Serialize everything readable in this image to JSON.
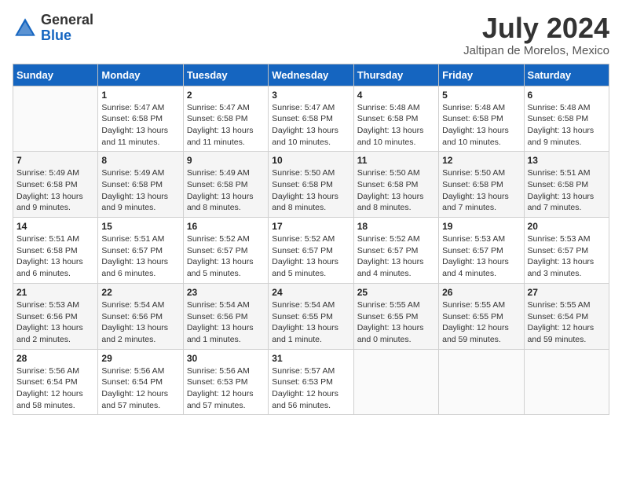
{
  "header": {
    "logo_general": "General",
    "logo_blue": "Blue",
    "month_title": "July 2024",
    "subtitle": "Jaltipan de Morelos, Mexico"
  },
  "columns": [
    "Sunday",
    "Monday",
    "Tuesday",
    "Wednesday",
    "Thursday",
    "Friday",
    "Saturday"
  ],
  "weeks": [
    [
      null,
      {
        "day": "1",
        "sunrise": "5:47 AM",
        "sunset": "6:58 PM",
        "daylight": "13 hours and 11 minutes."
      },
      {
        "day": "2",
        "sunrise": "5:47 AM",
        "sunset": "6:58 PM",
        "daylight": "13 hours and 11 minutes."
      },
      {
        "day": "3",
        "sunrise": "5:47 AM",
        "sunset": "6:58 PM",
        "daylight": "13 hours and 10 minutes."
      },
      {
        "day": "4",
        "sunrise": "5:48 AM",
        "sunset": "6:58 PM",
        "daylight": "13 hours and 10 minutes."
      },
      {
        "day": "5",
        "sunrise": "5:48 AM",
        "sunset": "6:58 PM",
        "daylight": "13 hours and 10 minutes."
      },
      {
        "day": "6",
        "sunrise": "5:48 AM",
        "sunset": "6:58 PM",
        "daylight": "13 hours and 9 minutes."
      }
    ],
    [
      {
        "day": "7",
        "sunrise": "5:49 AM",
        "sunset": "6:58 PM",
        "daylight": "13 hours and 9 minutes."
      },
      {
        "day": "8",
        "sunrise": "5:49 AM",
        "sunset": "6:58 PM",
        "daylight": "13 hours and 9 minutes."
      },
      {
        "day": "9",
        "sunrise": "5:49 AM",
        "sunset": "6:58 PM",
        "daylight": "13 hours and 8 minutes."
      },
      {
        "day": "10",
        "sunrise": "5:50 AM",
        "sunset": "6:58 PM",
        "daylight": "13 hours and 8 minutes."
      },
      {
        "day": "11",
        "sunrise": "5:50 AM",
        "sunset": "6:58 PM",
        "daylight": "13 hours and 8 minutes."
      },
      {
        "day": "12",
        "sunrise": "5:50 AM",
        "sunset": "6:58 PM",
        "daylight": "13 hours and 7 minutes."
      },
      {
        "day": "13",
        "sunrise": "5:51 AM",
        "sunset": "6:58 PM",
        "daylight": "13 hours and 7 minutes."
      }
    ],
    [
      {
        "day": "14",
        "sunrise": "5:51 AM",
        "sunset": "6:58 PM",
        "daylight": "13 hours and 6 minutes."
      },
      {
        "day": "15",
        "sunrise": "5:51 AM",
        "sunset": "6:57 PM",
        "daylight": "13 hours and 6 minutes."
      },
      {
        "day": "16",
        "sunrise": "5:52 AM",
        "sunset": "6:57 PM",
        "daylight": "13 hours and 5 minutes."
      },
      {
        "day": "17",
        "sunrise": "5:52 AM",
        "sunset": "6:57 PM",
        "daylight": "13 hours and 5 minutes."
      },
      {
        "day": "18",
        "sunrise": "5:52 AM",
        "sunset": "6:57 PM",
        "daylight": "13 hours and 4 minutes."
      },
      {
        "day": "19",
        "sunrise": "5:53 AM",
        "sunset": "6:57 PM",
        "daylight": "13 hours and 4 minutes."
      },
      {
        "day": "20",
        "sunrise": "5:53 AM",
        "sunset": "6:57 PM",
        "daylight": "13 hours and 3 minutes."
      }
    ],
    [
      {
        "day": "21",
        "sunrise": "5:53 AM",
        "sunset": "6:56 PM",
        "daylight": "13 hours and 2 minutes."
      },
      {
        "day": "22",
        "sunrise": "5:54 AM",
        "sunset": "6:56 PM",
        "daylight": "13 hours and 2 minutes."
      },
      {
        "day": "23",
        "sunrise": "5:54 AM",
        "sunset": "6:56 PM",
        "daylight": "13 hours and 1 minutes."
      },
      {
        "day": "24",
        "sunrise": "5:54 AM",
        "sunset": "6:55 PM",
        "daylight": "13 hours and 1 minute."
      },
      {
        "day": "25",
        "sunrise": "5:55 AM",
        "sunset": "6:55 PM",
        "daylight": "13 hours and 0 minutes."
      },
      {
        "day": "26",
        "sunrise": "5:55 AM",
        "sunset": "6:55 PM",
        "daylight": "12 hours and 59 minutes."
      },
      {
        "day": "27",
        "sunrise": "5:55 AM",
        "sunset": "6:54 PM",
        "daylight": "12 hours and 59 minutes."
      }
    ],
    [
      {
        "day": "28",
        "sunrise": "5:56 AM",
        "sunset": "6:54 PM",
        "daylight": "12 hours and 58 minutes."
      },
      {
        "day": "29",
        "sunrise": "5:56 AM",
        "sunset": "6:54 PM",
        "daylight": "12 hours and 57 minutes."
      },
      {
        "day": "30",
        "sunrise": "5:56 AM",
        "sunset": "6:53 PM",
        "daylight": "12 hours and 57 minutes."
      },
      {
        "day": "31",
        "sunrise": "5:57 AM",
        "sunset": "6:53 PM",
        "daylight": "12 hours and 56 minutes."
      },
      null,
      null,
      null
    ]
  ]
}
